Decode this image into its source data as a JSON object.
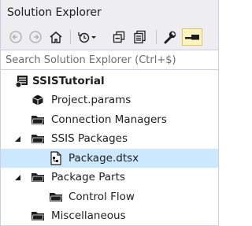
{
  "window": {
    "title": "Solution Explorer"
  },
  "toolbar": {
    "buttons": [
      {
        "name": "back-icon"
      },
      {
        "name": "forward-icon"
      },
      {
        "name": "home-icon"
      },
      {
        "name": "pending-changes-filter-icon"
      },
      {
        "name": "collapse-all-icon"
      },
      {
        "name": "show-all-files-icon"
      },
      {
        "name": "properties-icon"
      },
      {
        "name": "preview-selected-items-icon",
        "active": true
      }
    ]
  },
  "search": {
    "placeholder": "Search Solution Explorer (Ctrl+$)"
  },
  "tree": {
    "items": [
      {
        "label": "SSISTutorial",
        "icon": "project-icon",
        "bold": true
      },
      {
        "label": "Project.params",
        "icon": "params-icon"
      },
      {
        "label": "Connection Managers",
        "icon": "folder-icon"
      },
      {
        "label": "SSIS Packages",
        "icon": "folder-icon",
        "expanded": true
      },
      {
        "label": "Package.dtsx",
        "icon": "package-file-icon",
        "selected": true
      },
      {
        "label": "Package Parts",
        "icon": "folder-icon",
        "expanded": true
      },
      {
        "label": "Control Flow",
        "icon": "folder-icon"
      },
      {
        "label": "Miscellaneous",
        "icon": "folder-icon"
      }
    ]
  },
  "colors": {
    "selection": "#cce8ff",
    "chrome": "#eeeef2",
    "text": "#1e1e1e"
  }
}
